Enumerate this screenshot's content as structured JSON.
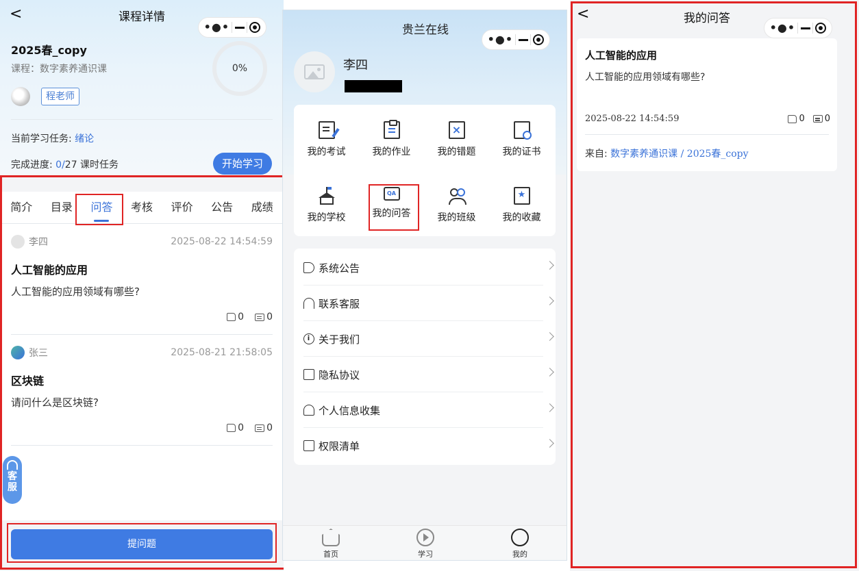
{
  "panel1": {
    "nav_title": "课程详情",
    "class_name": "2025春_copy",
    "course_line": "课程：数字素养通识课",
    "progress_percent_label": "0%",
    "teacher": "程老师",
    "current_task_label": "当前学习任务:",
    "current_task_value": "绪论",
    "completion_label": "完成进度:",
    "completion_done": "0/",
    "completion_rest": "27 课时任务",
    "start_button": "开始学习",
    "tabs": [
      "简介",
      "目录",
      "问答",
      "考核",
      "评价",
      "公告",
      "成绩"
    ],
    "active_tab": "问答",
    "questions": [
      {
        "user": "李四",
        "time": "2025-08-22 14:54:59",
        "title": "人工智能的应用",
        "desc": "人工智能的应用领域有哪些?",
        "likes": "0",
        "comments": "0"
      },
      {
        "user": "张三",
        "time": "2025-08-21 21:58:05",
        "title": "区块链",
        "desc": "请问什么是区块链?",
        "likes": "0",
        "comments": "0"
      }
    ],
    "service_float": "客服",
    "ask_button": "提问题"
  },
  "panel2": {
    "nav_title": "贵兰在线",
    "user_name": "李四",
    "grid": [
      {
        "label": "我的考试",
        "icon": "exam-icon"
      },
      {
        "label": "我的作业",
        "icon": "homework-icon"
      },
      {
        "label": "我的错题",
        "icon": "wrong-questions-icon"
      },
      {
        "label": "我的证书",
        "icon": "certificate-icon"
      },
      {
        "label": "我的学校",
        "icon": "school-icon"
      },
      {
        "label": "我的问答",
        "icon": "qa-icon"
      },
      {
        "label": "我的班级",
        "icon": "class-icon"
      },
      {
        "label": "我的收藏",
        "icon": "favorites-icon"
      }
    ],
    "menu": [
      {
        "label": "系统公告",
        "icon": "speaker-icon"
      },
      {
        "label": "联系客服",
        "icon": "headset-icon"
      },
      {
        "label": "关于我们",
        "icon": "info-icon"
      },
      {
        "label": "隐私协议",
        "icon": "book-icon"
      },
      {
        "label": "个人信息收集",
        "icon": "person-icon"
      },
      {
        "label": "权限清单",
        "icon": "list-icon"
      }
    ],
    "tabbar": [
      {
        "label": "首页",
        "icon": "home-icon"
      },
      {
        "label": "学习",
        "icon": "play-icon"
      },
      {
        "label": "我的",
        "icon": "me-icon"
      }
    ]
  },
  "panel3": {
    "nav_title": "我的问答",
    "question": {
      "title": "人工智能的应用",
      "desc": "人工智能的应用领域有哪些?",
      "time": "2025-08-22 14:54:59",
      "likes": "0",
      "comments": "0",
      "from_label": "来自:",
      "from_value": "数字素养通识课 / 2025春_copy"
    }
  },
  "colors": {
    "accent": "#3f7be3",
    "link": "#3a72d8",
    "highlight_box": "#e02424"
  }
}
